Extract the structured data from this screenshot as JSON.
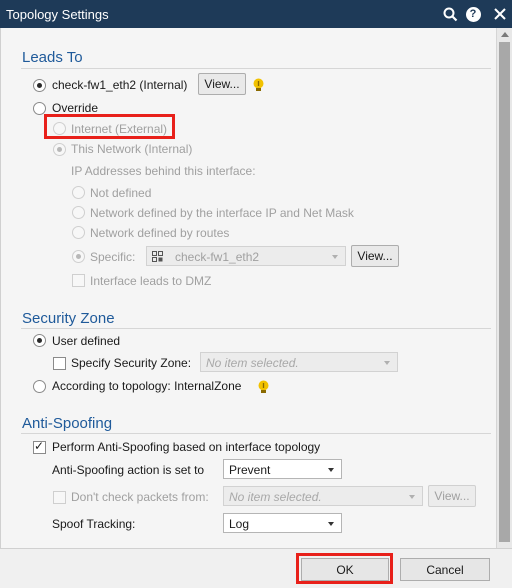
{
  "window": {
    "title": "Topology Settings"
  },
  "leads_to": {
    "title": "Leads To",
    "interface_option": "check-fw1_eth2 (Internal)",
    "view_label": "View...",
    "override_label": "Override",
    "internet_label": "Internet (External)",
    "this_network_label": "This Network (Internal)",
    "ip_behind_label": "IP Addresses behind this interface:",
    "not_defined_label": "Not defined",
    "net_defined_ip_label": "Network defined by the interface IP and Net Mask",
    "net_defined_routes_label": "Network defined by routes",
    "specific_label": "Specific:",
    "specific_value": "check-fw1_eth2",
    "specific_view_label": "View...",
    "dmz_label": "Interface leads to DMZ"
  },
  "security_zone": {
    "title": "Security Zone",
    "user_defined_label": "User defined",
    "specify_label": "Specify Security Zone:",
    "specify_placeholder": "No item selected.",
    "topology_label": "According to topology: InternalZone"
  },
  "anti_spoofing": {
    "title": "Anti-Spoofing",
    "perform_label": "Perform Anti-Spoofing based on interface topology",
    "action_label": "Anti-Spoofing action is set to",
    "action_value": "Prevent",
    "dont_check_label": "Don't check packets from:",
    "dont_check_placeholder": "No item selected.",
    "dont_check_view_label": "View...",
    "spoof_tracking_label": "Spoof Tracking:",
    "spoof_tracking_value": "Log"
  },
  "footer": {
    "ok_label": "OK",
    "cancel_label": "Cancel"
  },
  "colors": {
    "title_bar": "#1e3a58",
    "section_title": "#1f5a9a",
    "highlight": "#e8201a",
    "hint_bulb": "#f2c200"
  }
}
